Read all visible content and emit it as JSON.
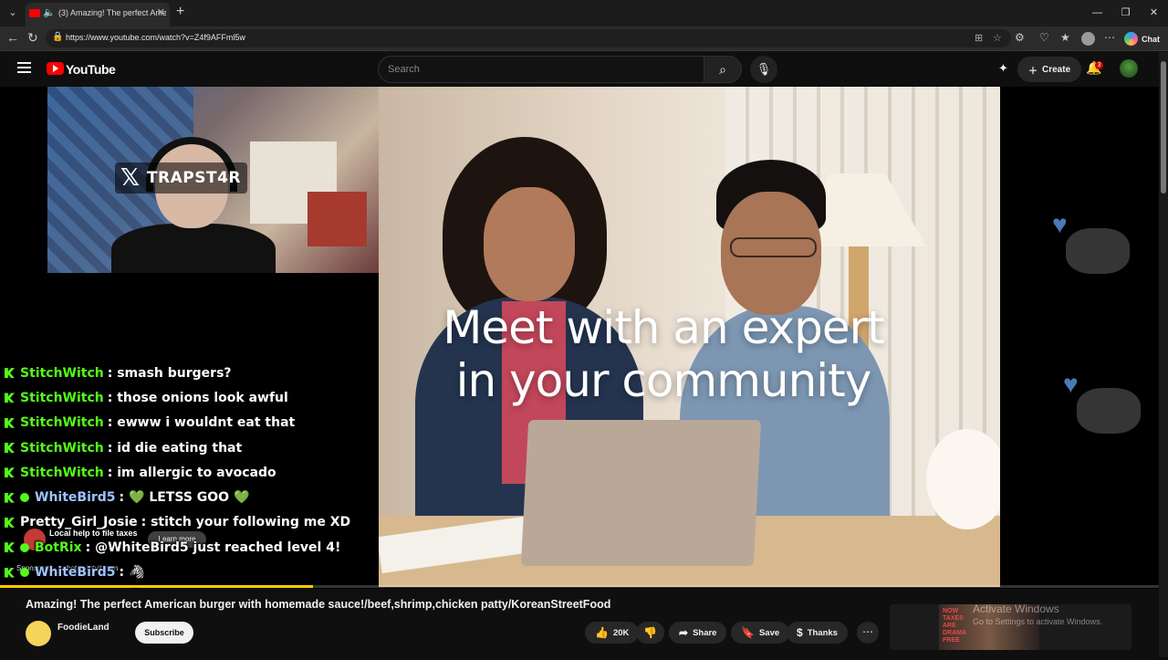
{
  "browser": {
    "tab_title": "(3) Amazing! The perfect American burger with homemade sauce",
    "url": "https://www.youtube.com/watch?v=Z4f9AFFml5w",
    "copilot_label": "Chat",
    "icons": [
      "tab-list-icon",
      "youtube-favicon-icon",
      "speaker-icon",
      "close-icon",
      "new-tab-icon",
      "back-icon",
      "reload-icon",
      "lock-icon",
      "split-screen-icon",
      "favorite-icon",
      "extensions-icon",
      "favorites-icon",
      "collections-icon",
      "profile-icon",
      "more-icon",
      "copilot-icon"
    ]
  },
  "youtube": {
    "logo_text": "YouTube",
    "search_placeholder": "Search",
    "create_label": "Create",
    "notification_count": "3"
  },
  "player": {
    "video_overlay_text_1": "Meet with an expert",
    "video_overlay_text_2": "in your community",
    "stream_handle": "TRAPST4R",
    "ad_title": "Local help to file taxes",
    "ad_button": "Learn more",
    "ad_domain": "Sponsored · turbotax.intuit.com",
    "progress_fraction": 0.27
  },
  "chat": [
    {
      "user": "StitchWitch",
      "msg": ": smash burgers?",
      "color": "#53fc18",
      "verified": false
    },
    {
      "user": "StitchWitch",
      "msg": ": those onions look awful",
      "color": "#53fc18",
      "verified": false
    },
    {
      "user": "StitchWitch",
      "msg": ": ewww i wouldnt eat that",
      "color": "#53fc18",
      "verified": false
    },
    {
      "user": "StitchWitch",
      "msg": ": id die eating that",
      "color": "#53fc18",
      "verified": false
    },
    {
      "user": "StitchWitch",
      "msg": ": im allergic to avocado",
      "color": "#53fc18",
      "verified": false
    },
    {
      "user": "WhiteBird5",
      "msg": ": 💚 LETSS GOO 💚",
      "color": "#9ec3ff",
      "verified": true
    },
    {
      "user": "Pretty_Girl_Josie",
      "msg": ": stitch your following me XD",
      "color": "#ffffff",
      "verified": false
    },
    {
      "user": "BotRix",
      "msg": ": @WhiteBird5 just reached level 4!",
      "color": "#53fc18",
      "verified": true
    },
    {
      "user": "WhiteBird5",
      "msg": ": 🦓",
      "color": "#9ec3ff",
      "verified": true
    },
    {
      "user": "WhiteBird5",
      "msg": ": 🦓",
      "color": "#9ec3ff",
      "verified": true
    },
    {
      "user": "WhiteBird5",
      "msg": ": 🦓",
      "color": "#9ec3ff",
      "verified": true
    },
    {
      "user": "WhiteBird5",
      "msg": ": 🦓",
      "color": "#9ec3ff",
      "verified": true
    }
  ],
  "video_info": {
    "title": "Amazing! The perfect American burger with homemade sauce!/beef,shrimp,chicken patty/KoreanStreetFood",
    "channel": "FoodieLand",
    "subscribe_label": "Subscribe",
    "like_count": "20K",
    "share_label": "Share",
    "save_label": "Save",
    "thanks_label": "Thanks",
    "ad_thumb_text": "NOW TAXES ARE DRAMA FREE"
  },
  "system": {
    "activate_title": "Activate Windows",
    "activate_sub": "Go to Settings to activate Windows."
  }
}
